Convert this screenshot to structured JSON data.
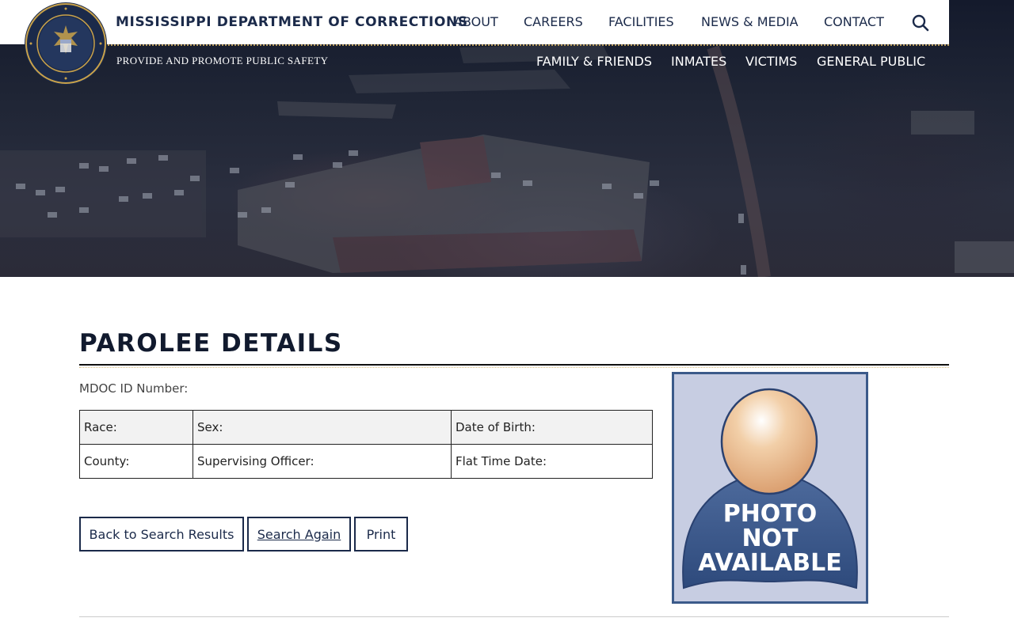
{
  "header": {
    "org_name": "MISSISSIPPI DEPARTMENT OF CORRECTIONS",
    "tagline": "PROVIDE AND PROMOTE PUBLIC SAFETY",
    "primary_nav": [
      "ABOUT",
      "CAREERS",
      "FACILITIES",
      "NEWS & MEDIA",
      "CONTACT"
    ],
    "secondary_nav": [
      "FAMILY & FRIENDS",
      "INMATES",
      "VICTIMS",
      "GENERAL PUBLIC"
    ],
    "search_icon": "search-icon",
    "seal_icon": "state-seal"
  },
  "main": {
    "title": "PAROLEE DETAILS",
    "mdoc_id_label": "MDOC ID Number:",
    "details_rows": [
      [
        "Race:",
        "Sex:",
        "Date of Birth:"
      ],
      [
        "County:",
        "Supervising Officer:",
        "Flat Time Date:"
      ]
    ],
    "buttons": {
      "back": "Back to Search Results",
      "search_again": "Search Again",
      "print": "Print"
    },
    "photo_placeholder": {
      "line1": "PHOTO",
      "line2": "NOT",
      "line3": "AVAILABLE"
    }
  },
  "colors": {
    "navy": "#1b2a4a",
    "gold_accent": "#b69a5a",
    "photo_bg": "#c7cde2",
    "photo_body": "#3b5a8a"
  }
}
